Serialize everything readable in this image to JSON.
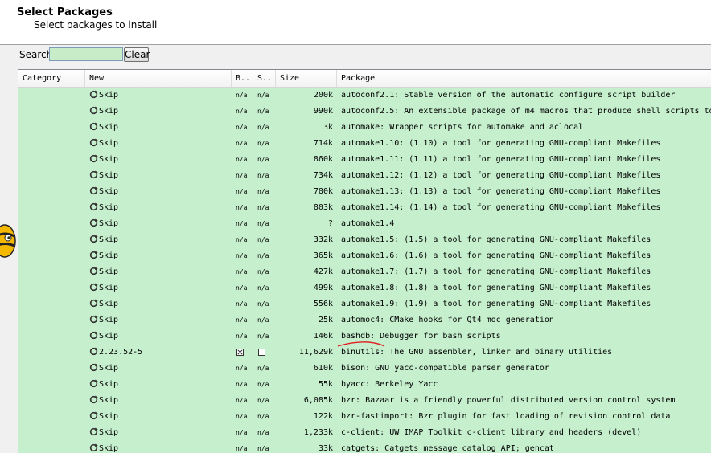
{
  "header": {
    "title": "Select Packages",
    "subtitle": "Select packages to install"
  },
  "search": {
    "label": "Search",
    "value": "",
    "clear_label": "Clear"
  },
  "columns": [
    "Category",
    "New",
    "B..",
    "S..",
    "Size",
    "Package"
  ],
  "rows": [
    {
      "new": "Skip",
      "bin": "n/a",
      "src": "n/a",
      "size": "200k",
      "pkg": "autoconf2.1: Stable version of the automatic configure script builder"
    },
    {
      "new": "Skip",
      "bin": "n/a",
      "src": "n/a",
      "size": "990k",
      "pkg": "autoconf2.5: An extensible package of m4 macros that produce shell scripts to"
    },
    {
      "new": "Skip",
      "bin": "n/a",
      "src": "n/a",
      "size": "3k",
      "pkg": "automake: Wrapper scripts for automake and aclocal"
    },
    {
      "new": "Skip",
      "bin": "n/a",
      "src": "n/a",
      "size": "714k",
      "pkg": "automake1.10: (1.10) a tool for generating GNU-compliant Makefiles"
    },
    {
      "new": "Skip",
      "bin": "n/a",
      "src": "n/a",
      "size": "860k",
      "pkg": "automake1.11: (1.11) a tool for generating GNU-compliant Makefiles"
    },
    {
      "new": "Skip",
      "bin": "n/a",
      "src": "n/a",
      "size": "734k",
      "pkg": "automake1.12: (1.12) a tool for generating GNU-compliant Makefiles"
    },
    {
      "new": "Skip",
      "bin": "n/a",
      "src": "n/a",
      "size": "780k",
      "pkg": "automake1.13: (1.13) a tool for generating GNU-compliant Makefiles"
    },
    {
      "new": "Skip",
      "bin": "n/a",
      "src": "n/a",
      "size": "803k",
      "pkg": "automake1.14: (1.14) a tool for generating GNU-compliant Makefiles"
    },
    {
      "new": "Skip",
      "bin": "n/a",
      "src": "n/a",
      "size": "?",
      "pkg": "automake1.4"
    },
    {
      "new": "Skip",
      "bin": "n/a",
      "src": "n/a",
      "size": "332k",
      "pkg": "automake1.5: (1.5) a tool for generating GNU-compliant Makefiles"
    },
    {
      "new": "Skip",
      "bin": "n/a",
      "src": "n/a",
      "size": "365k",
      "pkg": "automake1.6: (1.6) a tool for generating GNU-compliant Makefiles"
    },
    {
      "new": "Skip",
      "bin": "n/a",
      "src": "n/a",
      "size": "427k",
      "pkg": "automake1.7: (1.7) a tool for generating GNU-compliant Makefiles"
    },
    {
      "new": "Skip",
      "bin": "n/a",
      "src": "n/a",
      "size": "499k",
      "pkg": "automake1.8: (1.8) a tool for generating GNU-compliant Makefiles"
    },
    {
      "new": "Skip",
      "bin": "n/a",
      "src": "n/a",
      "size": "556k",
      "pkg": "automake1.9: (1.9) a tool for generating GNU-compliant Makefiles"
    },
    {
      "new": "Skip",
      "bin": "n/a",
      "src": "n/a",
      "size": "25k",
      "pkg": "automoc4: CMake hooks for Qt4 moc generation"
    },
    {
      "new": "Skip",
      "bin": "n/a",
      "src": "n/a",
      "size": "146k",
      "pkg": "bashdb: Debugger for bash scripts"
    },
    {
      "new": "2.23.52-5",
      "bin": "checked",
      "src": "unchecked",
      "size": "11,629k",
      "pkg": "binutils: The GNU assembler, linker and binary utilities"
    },
    {
      "new": "Skip",
      "bin": "n/a",
      "src": "n/a",
      "size": "610k",
      "pkg": "bison: GNU yacc-compatible parser generator"
    },
    {
      "new": "Skip",
      "bin": "n/a",
      "src": "n/a",
      "size": "55k",
      "pkg": "byacc: Berkeley Yacc"
    },
    {
      "new": "Skip",
      "bin": "n/a",
      "src": "n/a",
      "size": "6,085k",
      "pkg": "bzr: Bazaar is a friendly powerful distributed version control system"
    },
    {
      "new": "Skip",
      "bin": "n/a",
      "src": "n/a",
      "size": "122k",
      "pkg": "bzr-fastimport: Bzr plugin for fast loading of revision control data"
    },
    {
      "new": "Skip",
      "bin": "n/a",
      "src": "n/a",
      "size": "1,233k",
      "pkg": "c-client: UW IMAP Toolkit c-client library and headers (devel)"
    },
    {
      "new": "Skip",
      "bin": "n/a",
      "src": "n/a",
      "size": "33k",
      "pkg": "catgets: Catgets message catalog API; gencat"
    }
  ],
  "highlight": {
    "row_index": 16,
    "color": "#e02020"
  },
  "colors": {
    "row_bg": "#c6efce",
    "icon": "#333333"
  },
  "icons": {
    "cycle": "cycle-icon",
    "mascot": "cygwin-mascot-icon"
  }
}
